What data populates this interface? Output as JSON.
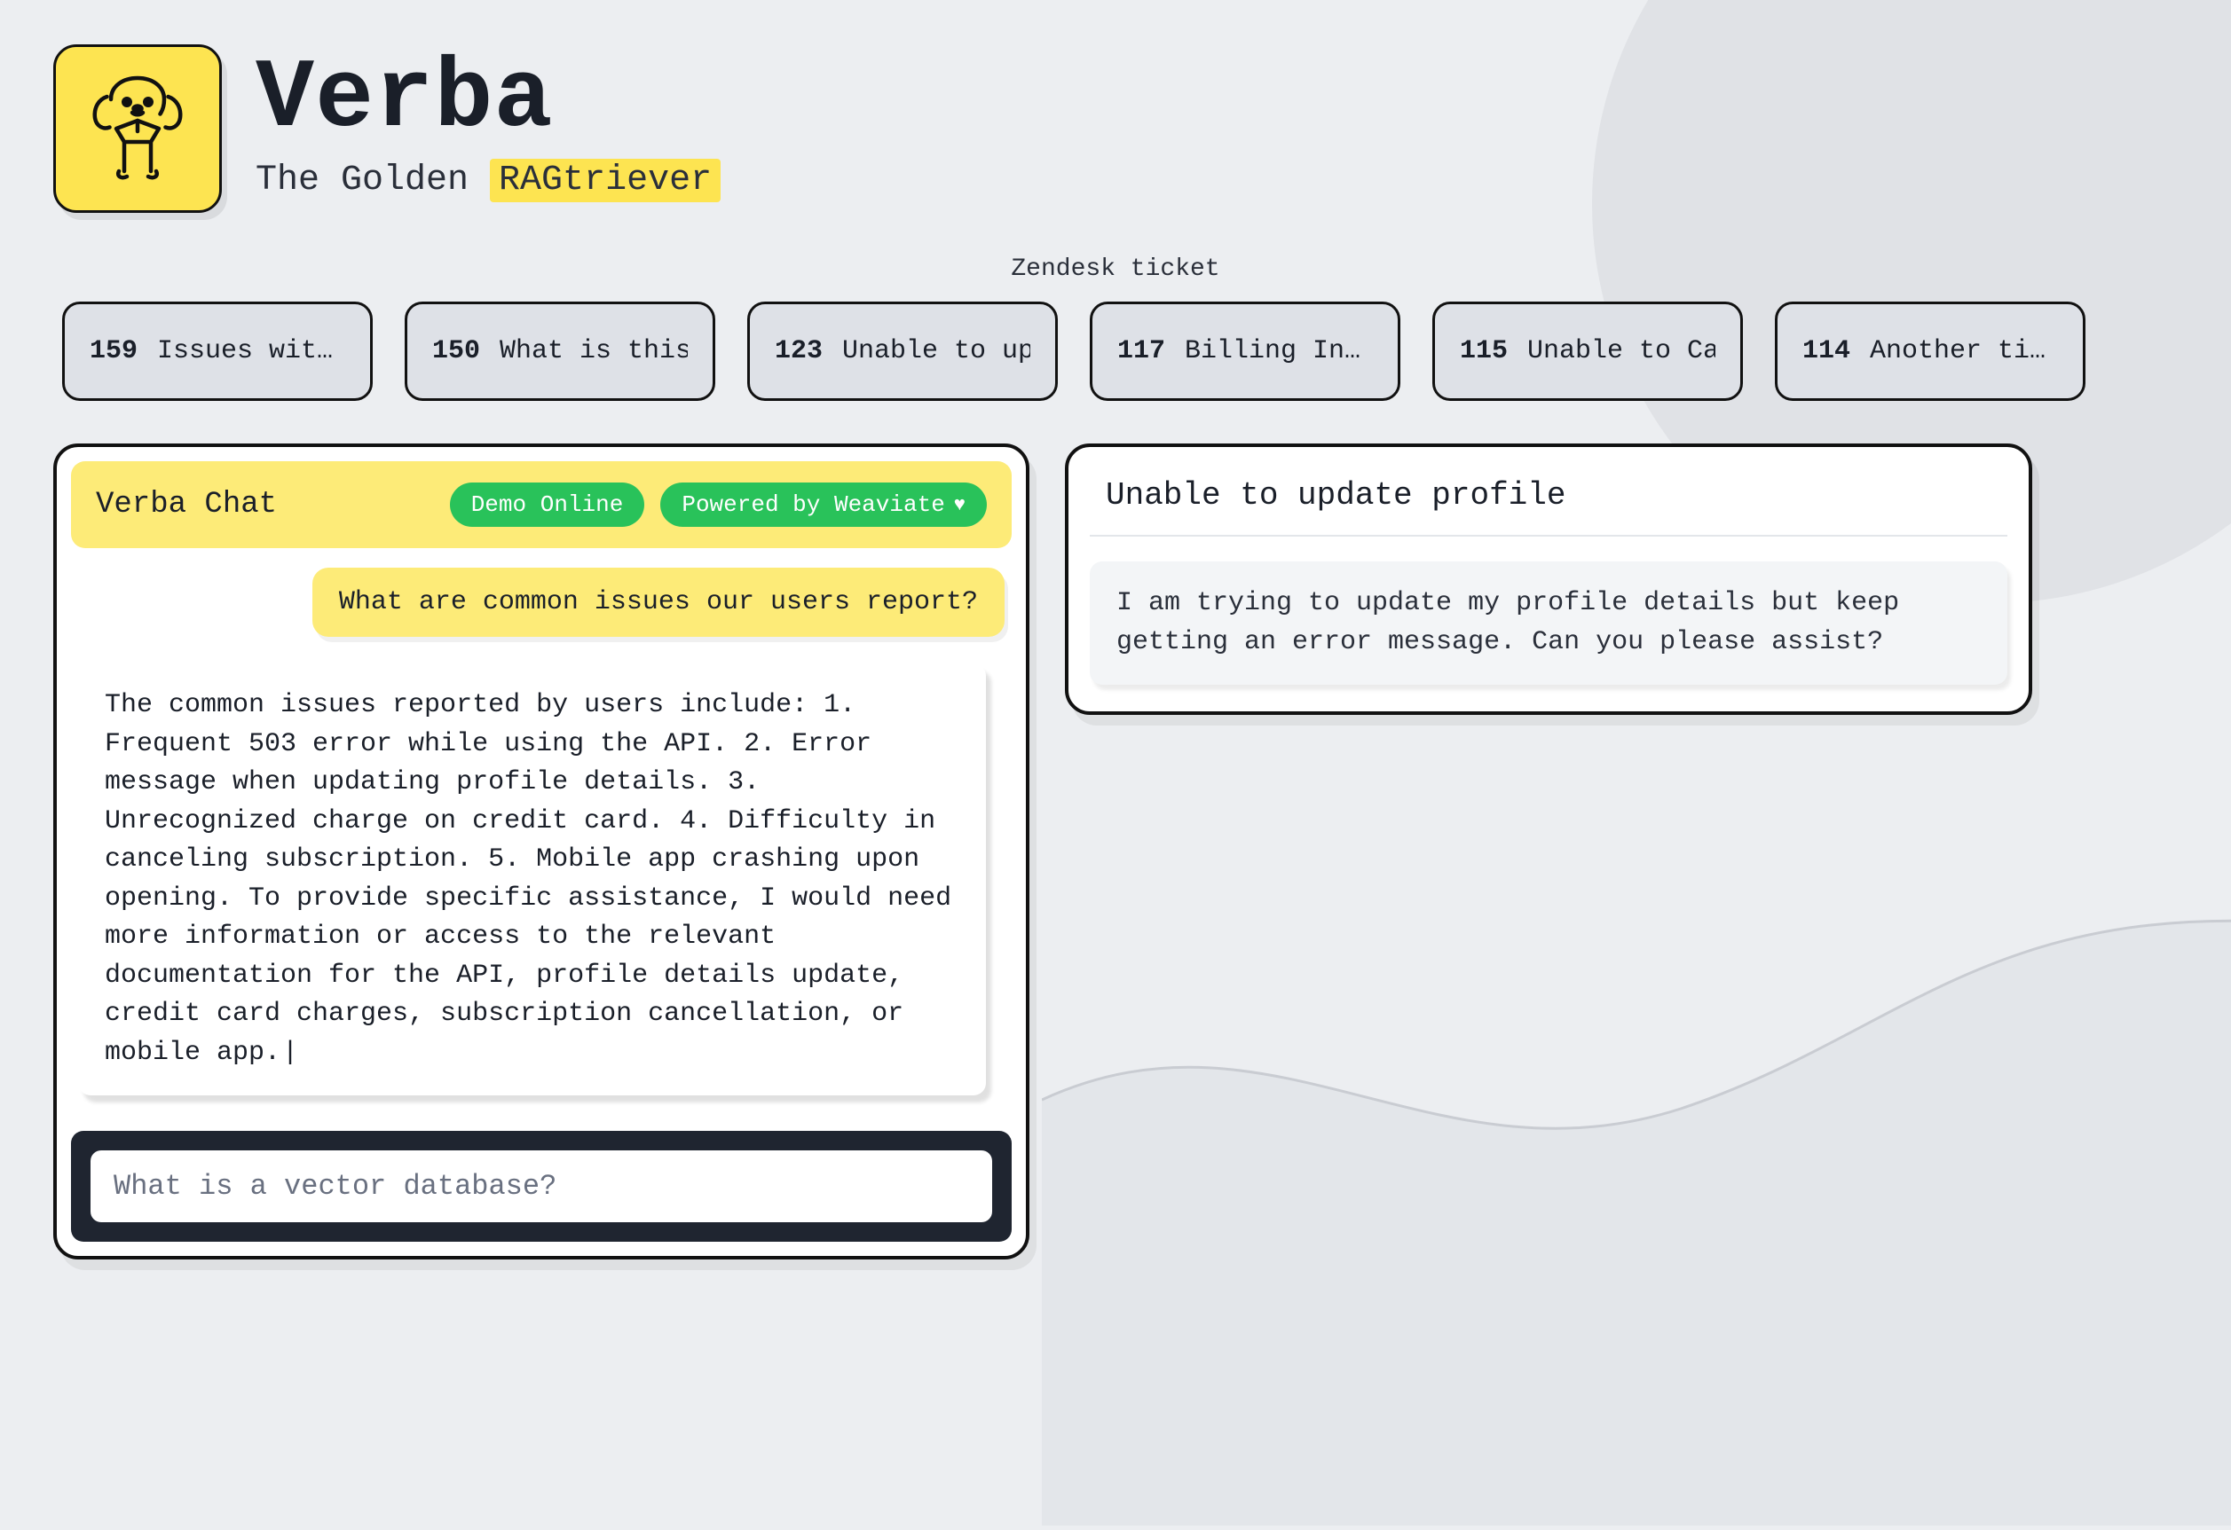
{
  "brand": {
    "name": "Verba",
    "subtitle_prefix": "The Golden ",
    "subtitle_highlight": "RAGtriever"
  },
  "section_label": "Zendesk ticket",
  "tickets": [
    {
      "id": "159",
      "title": "Issues with API"
    },
    {
      "id": "150",
      "title": "What is this ticke"
    },
    {
      "id": "123",
      "title": "Unable to update p"
    },
    {
      "id": "117",
      "title": "Billing Inquiry"
    },
    {
      "id": "115",
      "title": "Unable to Cancel S"
    },
    {
      "id": "114",
      "title": "Another ticket"
    }
  ],
  "chat": {
    "header_title": "Verba Chat",
    "status_pill": "Demo Online",
    "powered_pill": "Powered by Weaviate",
    "user_message": "What are common issues our users report?",
    "bot_message": "The common issues reported by users include: 1. Frequent 503 error while using the API. 2. Error message when updating profile details. 3. Unrecognized charge on credit card. 4. Difficulty in canceling subscription. 5. Mobile app crashing upon opening. To provide specific assistance, I would need more information or access to the relevant documentation for the API, profile details update, credit card charges, subscription cancellation, or mobile app.",
    "input_placeholder": "What is a vector database?"
  },
  "doc": {
    "title": "Unable to update profile",
    "body": "I am trying to update my profile details but keep getting an error message. Can you please assist?"
  },
  "colors": {
    "accent_yellow": "#fde451",
    "accent_green": "#29c25a",
    "dark": "#1f2530"
  }
}
